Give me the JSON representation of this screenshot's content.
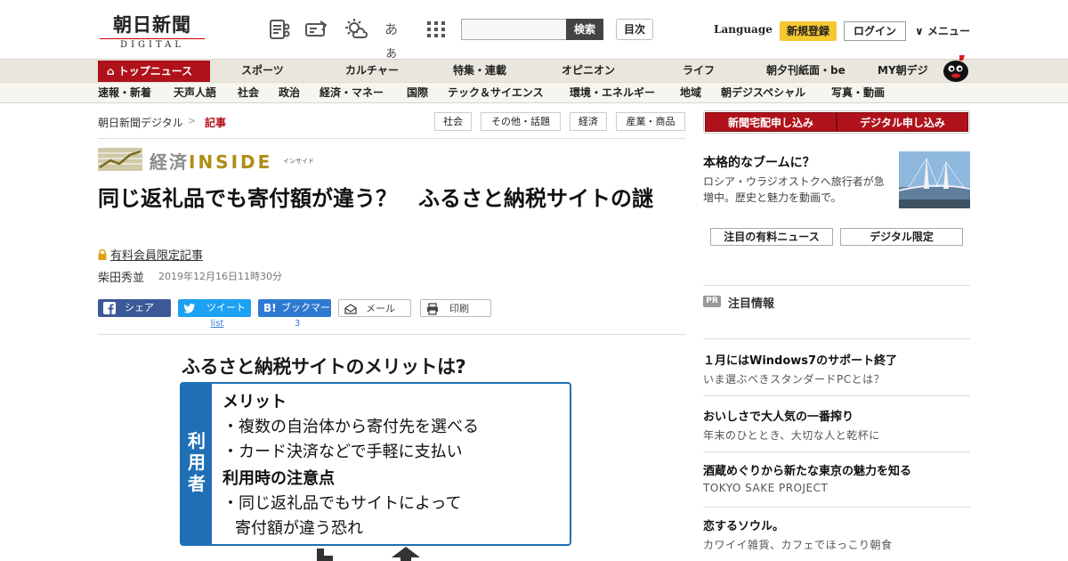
{
  "header": {
    "logo_main": "朝日新聞",
    "logo_sub": "DIGITAL",
    "search_button": "検索",
    "index_button": "目次",
    "language": "Language",
    "signup": "新規登録",
    "login": "ログイン",
    "menu": "メニュー",
    "icons": [
      "newspaper-icon",
      "ticket-icon",
      "weather-icon",
      "font-size-icon",
      "grid-icon"
    ],
    "font_size_glyph": "あぁ"
  },
  "nav_main": {
    "top": "トップニュース",
    "items": [
      "スポーツ",
      "カルチャー",
      "特集・連載",
      "オピニオン",
      "ライフ",
      "朝夕刊紙面・be",
      "MY朝デジ"
    ]
  },
  "nav_sub": {
    "items": [
      "速報・新着",
      "天声人語",
      "社会",
      "政治",
      "経済・マネー",
      "国際",
      "テック＆サイエンス",
      "環境・エネルギー",
      "地域",
      "朝デジスペシャル",
      "写真・動画"
    ]
  },
  "breadcrumb": {
    "home": "朝日新聞デジタル",
    "separator": ">",
    "current": "記事"
  },
  "tags": [
    "社会",
    "その他・話題",
    "経済",
    "産業・商品"
  ],
  "banner": {
    "kanji": "経済",
    "word": "INSIDE",
    "ruby": "インサイド"
  },
  "article": {
    "headline": "同じ返礼品でも寄付額が違う？　ふるさと納税サイトの謎",
    "paid_label": "有料会員限定記事",
    "author": "柴田秀並",
    "date": "2019年12月16日11時30分"
  },
  "share": {
    "facebook": "シェア",
    "twitter": "ツイート",
    "hatena": "ブックマーク",
    "mail": "メール",
    "print": "印刷",
    "twitter_count": "list",
    "hatena_count": "3"
  },
  "figure": {
    "title": "ふるさと納税サイトのメリットは?",
    "band": "利用者",
    "merit_head": "メリット",
    "merit_1": "・複数の自治体から寄付先を選べる",
    "merit_2": "・カード決済などで手軽に支払い",
    "caution_head": "利用時の注意点",
    "caution_1": "・同じ返礼品でもサイトによって",
    "caution_2": "寄付額が違う恐れ"
  },
  "sidebar": {
    "subscribe_paper": "新聞宅配申し込み",
    "subscribe_digital": "デジタル申し込み",
    "ad_title": "本格的なブームに？",
    "ad_text": "ロシア・ウラジオストクへ旅行者が急増中。歴史と魅力を動画で。",
    "tab_1": "注目の有料ニュース",
    "tab_2": "デジタル限定",
    "pr_badge": "PR",
    "pr_heading": "注目情報",
    "pr_items": [
      {
        "title": "１月にはWindows7のサポート終了",
        "sub": "いま選ぶべきスタンダードPCとは？"
      },
      {
        "title": "おいしさで大人気の一番搾り",
        "sub": "年末のひととき、大切な人と乾杯に"
      },
      {
        "title": "酒蔵めぐりから新たな東京の魅力を知る",
        "sub": "TOKYO SAKE PROJECT"
      },
      {
        "title": "恋するソウル。",
        "sub": "カワイイ雑貨、カフェでほっこり朝食"
      }
    ]
  },
  "colors": {
    "brand_red": "#b0121b",
    "signup_yellow": "#f5c830",
    "facebook": "#3b5998",
    "twitter": "#1da1f2",
    "hatena": "#2f7ad1",
    "figure_blue": "#1f6fb5",
    "inside_gold": "#b08d14"
  }
}
